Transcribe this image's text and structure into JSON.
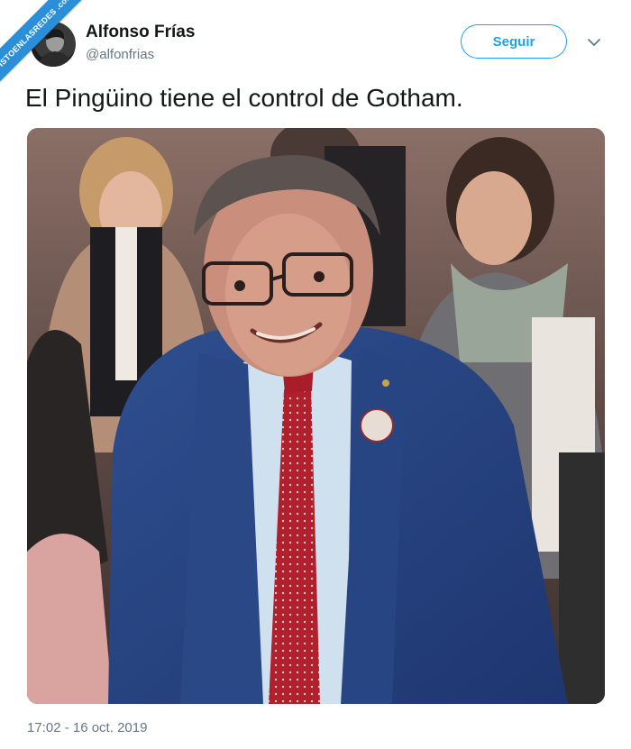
{
  "watermark": {
    "text": "VISTOENLASREDES .com"
  },
  "user": {
    "name": "Alfonso Frías",
    "handle": "@alfonfrias"
  },
  "follow_button": {
    "label": "Seguir"
  },
  "icons": {
    "menu": "chevron-down-icon",
    "avatar": "avatar-image"
  },
  "tweet": {
    "text": "El Pingüino tiene el control de Gotham."
  },
  "timestamp": "17:02 - 16 oct. 2019",
  "colors": {
    "accent": "#1da1f2",
    "text": "#14171a",
    "secondary": "#657786",
    "watermark": "#2a8fd8"
  }
}
